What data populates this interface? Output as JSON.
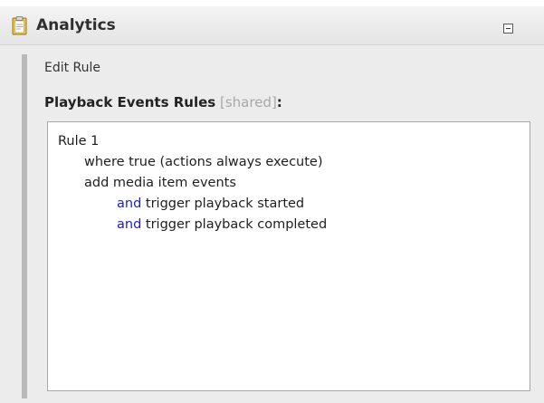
{
  "panel": {
    "title": "Analytics",
    "icon": "clipboard-icon",
    "collapse_icon": "minus-icon"
  },
  "editor": {
    "edit_label": "Edit Rule",
    "section_title": "Playback Events Rules",
    "shared_tag": "[shared]",
    "colon": ":"
  },
  "rule": {
    "name": "Rule 1",
    "condition": "where true (actions always execute)",
    "action": "add media item events",
    "clauses": [
      {
        "keyword": "and",
        "text": " trigger playback started"
      },
      {
        "keyword": "and",
        "text": " trigger playback completed"
      }
    ]
  },
  "colors": {
    "keyword": "#1c1ccf",
    "shared_tag": "#a8a8a8",
    "header_bg": "#ececec"
  }
}
